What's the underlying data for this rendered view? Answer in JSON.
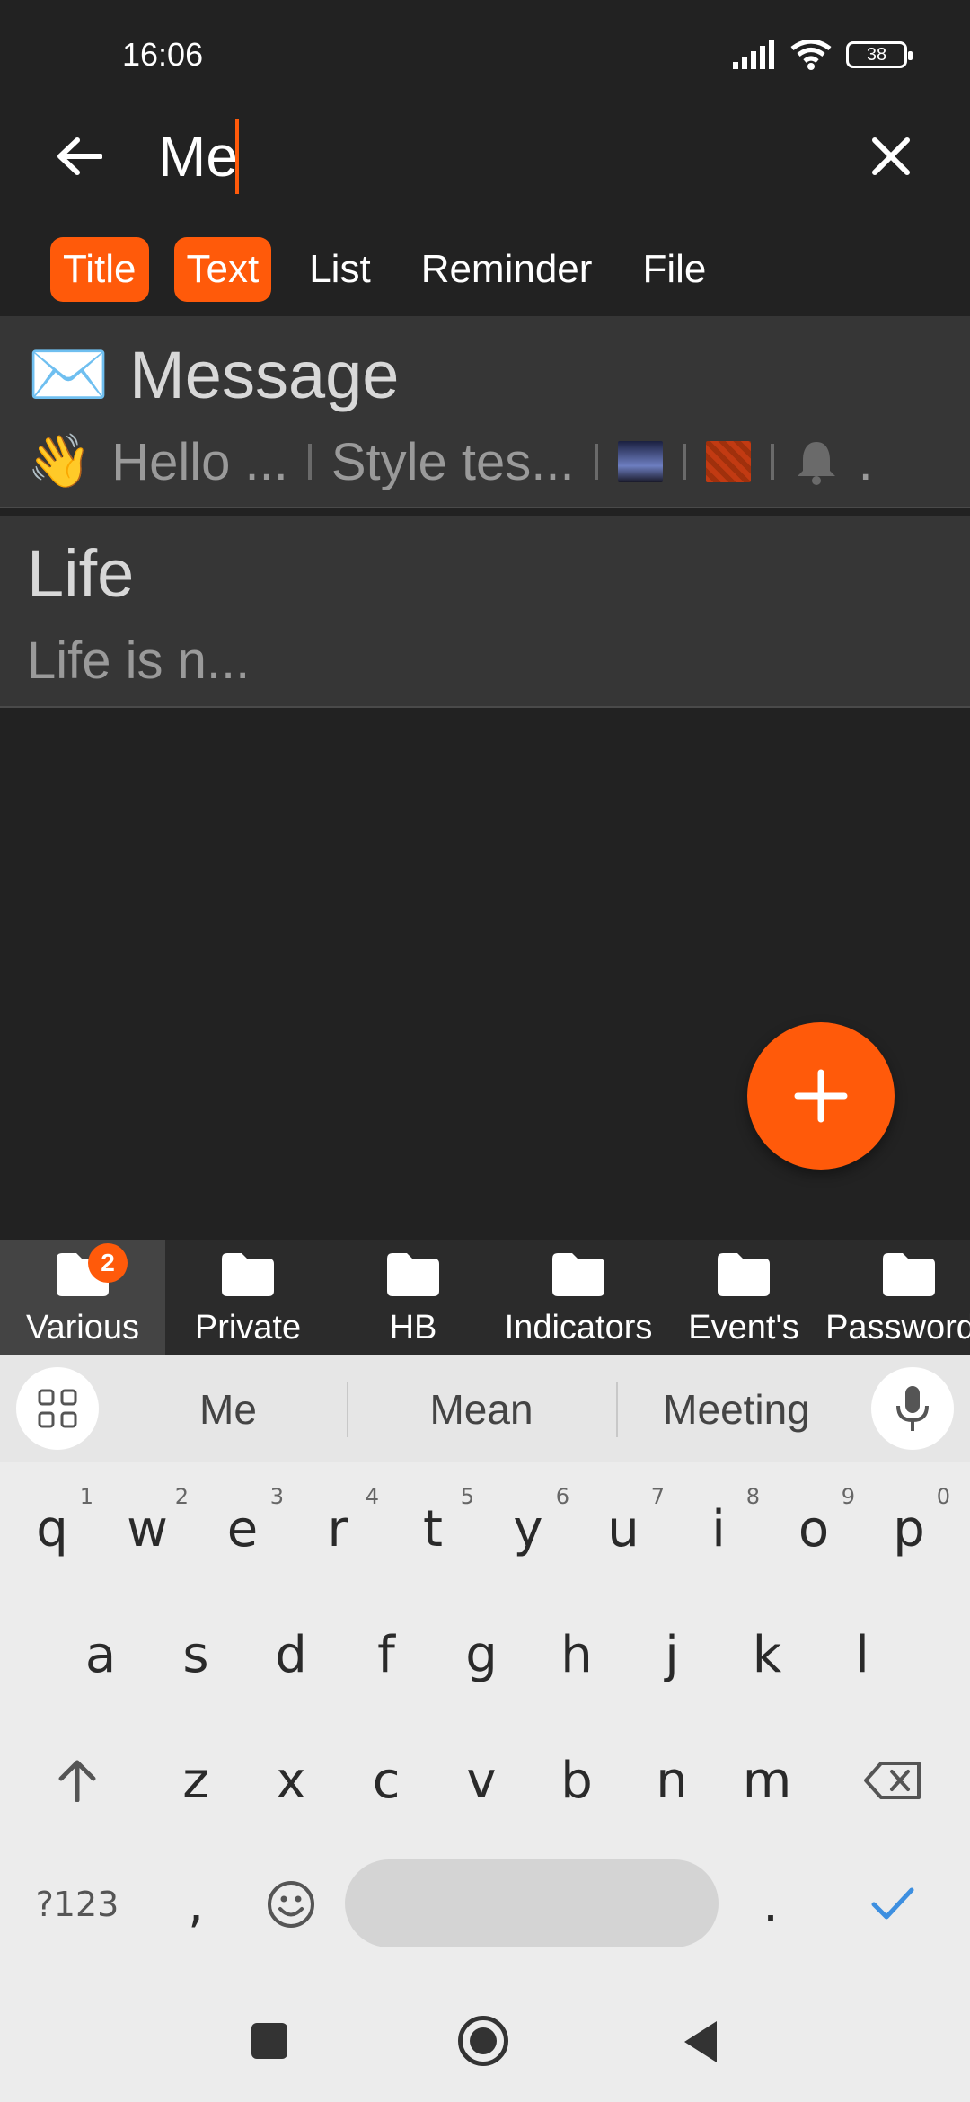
{
  "status": {
    "time": "16:06",
    "battery": "38"
  },
  "search": {
    "value": "Me"
  },
  "filters": [
    {
      "label": "Title",
      "active": true
    },
    {
      "label": "Text",
      "active": true
    },
    {
      "label": "List",
      "active": false
    },
    {
      "label": "Reminder",
      "active": false
    },
    {
      "label": "File",
      "active": false
    }
  ],
  "results": [
    {
      "emoji": "✉️",
      "title": "Message",
      "preview_emoji": "👋",
      "preview_1": "Hello ...",
      "preview_2": "Style tes...",
      "trailing": "."
    },
    {
      "title": "Life",
      "preview": "Life is n..."
    }
  ],
  "folders": [
    {
      "label": "Various",
      "badge": "2",
      "active": true
    },
    {
      "label": "Private"
    },
    {
      "label": "HB"
    },
    {
      "label": "Indicators"
    },
    {
      "label": "Event's"
    },
    {
      "label": "Passwords"
    }
  ],
  "keyboard": {
    "suggestions": [
      "Me",
      "Mean",
      "Meeting"
    ],
    "row1": [
      "q",
      "w",
      "e",
      "r",
      "t",
      "y",
      "u",
      "i",
      "o",
      "p"
    ],
    "row1_hints": [
      "1",
      "2",
      "3",
      "4",
      "5",
      "6",
      "7",
      "8",
      "9",
      "0"
    ],
    "row2": [
      "a",
      "s",
      "d",
      "f",
      "g",
      "h",
      "j",
      "k",
      "l"
    ],
    "row3": [
      "z",
      "x",
      "c",
      "v",
      "b",
      "n",
      "m"
    ],
    "symbols_key": "?123",
    "comma_key": ",",
    "period_key": "."
  },
  "colors": {
    "accent": "#ff5a0a",
    "background": "#222222",
    "row": "#363636"
  }
}
